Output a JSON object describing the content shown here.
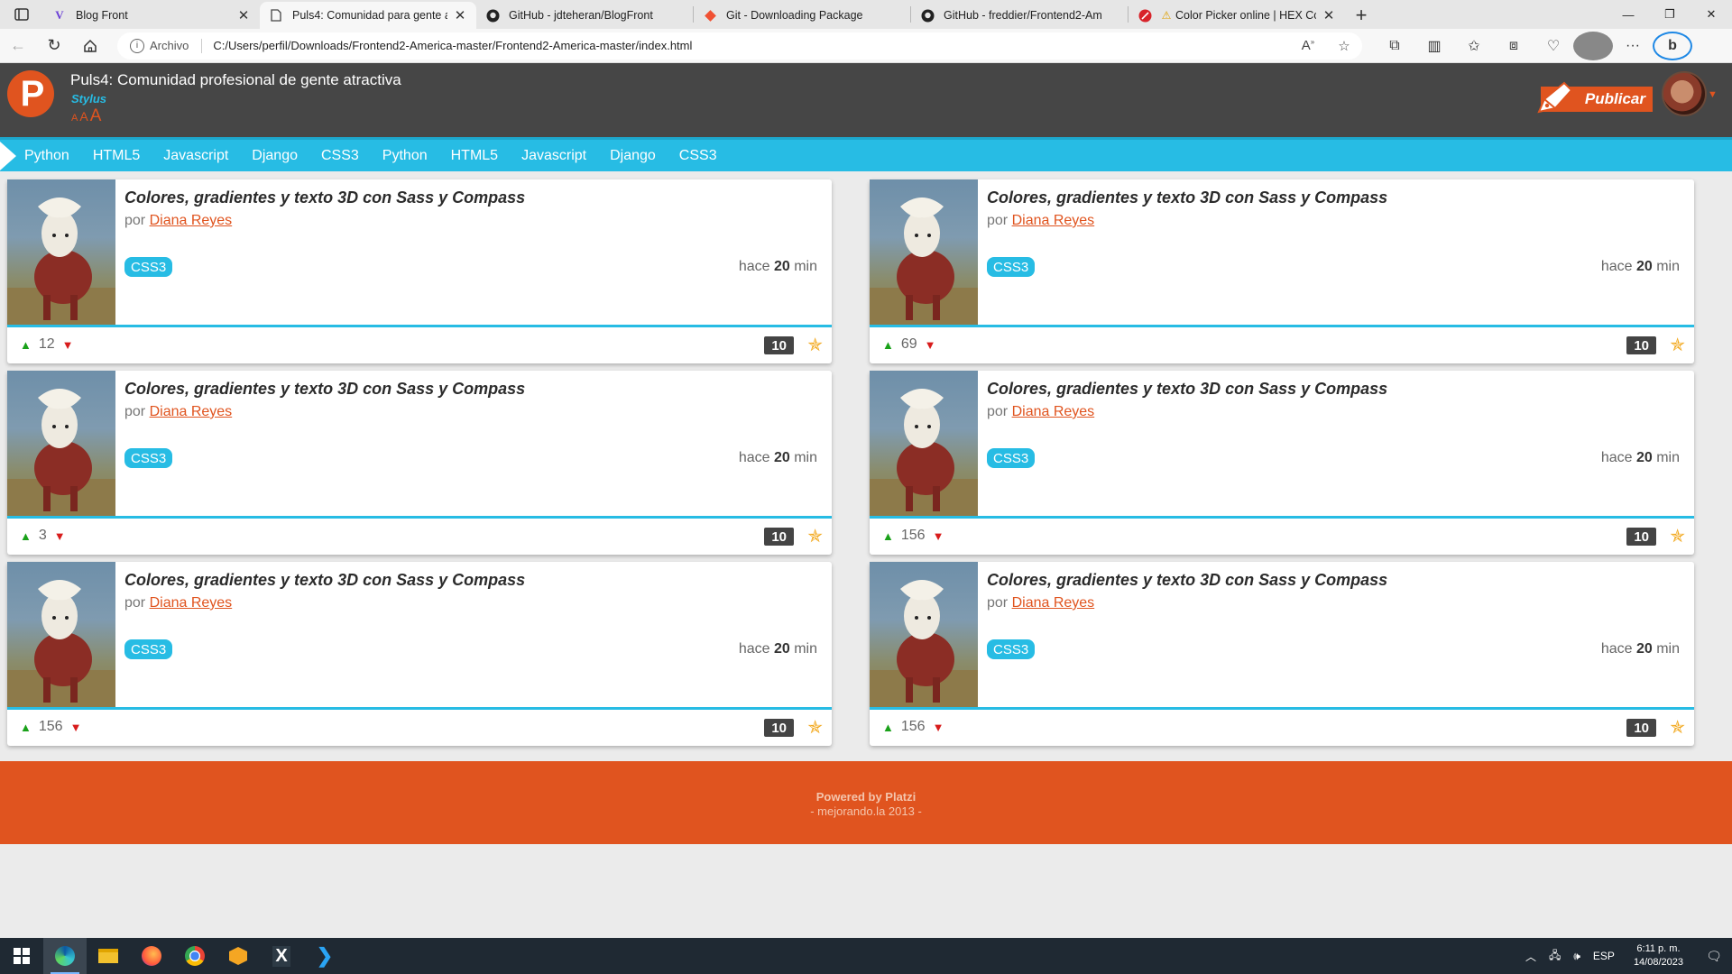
{
  "browser": {
    "tabs": [
      {
        "title": "Blog Front",
        "favicon": "v-logo-icon",
        "active": false
      },
      {
        "title": "Puls4: Comunidad para gente atr",
        "favicon": "page-icon",
        "active": true
      },
      {
        "title": "GitHub - jdteheran/BlogFront",
        "favicon": "github-icon",
        "active": false
      },
      {
        "title": "Git - Downloading Package",
        "favicon": "git-icon",
        "active": false
      },
      {
        "title": "GitHub - freddier/Frontend2-Am",
        "favicon": "github-icon",
        "active": false
      },
      {
        "title": "Color Picker online | HEX Colo",
        "favicon": "color-picker-icon",
        "active": false
      }
    ],
    "address": {
      "scheme_label": "Archivo",
      "url": "C:/Users/perfil/Downloads/Frontend2-America-master/Frontend2-America-master/index.html"
    }
  },
  "site": {
    "logo_letter": "P",
    "title": "Puls4: Comunidad profesional de gente atractiva",
    "subtitle": "Stylus",
    "font_sizer": [
      "A",
      "A",
      "A"
    ],
    "publish_label": "Publicar",
    "nav_tags": [
      "Python",
      "HTML5",
      "Javascript",
      "Django",
      "CSS3",
      "Python",
      "HTML5",
      "Javascript",
      "Django",
      "CSS3"
    ]
  },
  "posts": [
    {
      "title": "Colores, gradientes y texto 3D con Sass y Compass",
      "by": "por",
      "author": "Diana Reyes",
      "tag": "CSS3",
      "time_prefix": "hace",
      "time_value": "20",
      "time_unit": "min",
      "votes": "12",
      "count": "10"
    },
    {
      "title": "Colores, gradientes y texto 3D con Sass y Compass",
      "by": "por",
      "author": "Diana Reyes",
      "tag": "CSS3",
      "time_prefix": "hace",
      "time_value": "20",
      "time_unit": "min",
      "votes": "69",
      "count": "10"
    },
    {
      "title": "Colores, gradientes y texto 3D con Sass y Compass",
      "by": "por",
      "author": "Diana Reyes",
      "tag": "CSS3",
      "time_prefix": "hace",
      "time_value": "20",
      "time_unit": "min",
      "votes": "3",
      "count": "10"
    },
    {
      "title": "Colores, gradientes y texto 3D con Sass y Compass",
      "by": "por",
      "author": "Diana Reyes",
      "tag": "CSS3",
      "time_prefix": "hace",
      "time_value": "20",
      "time_unit": "min",
      "votes": "156",
      "count": "10"
    },
    {
      "title": "Colores, gradientes y texto 3D con Sass y Compass",
      "by": "por",
      "author": "Diana Reyes",
      "tag": "CSS3",
      "time_prefix": "hace",
      "time_value": "20",
      "time_unit": "min",
      "votes": "156",
      "count": "10"
    },
    {
      "title": "Colores, gradientes y texto 3D con Sass y Compass",
      "by": "por",
      "author": "Diana Reyes",
      "tag": "CSS3",
      "time_prefix": "hace",
      "time_value": "20",
      "time_unit": "min",
      "votes": "156",
      "count": "10"
    }
  ],
  "footer": {
    "line1": "Powered by Platzi",
    "line2": "- mejorando.la 2013 -"
  },
  "taskbar": {
    "apps": [
      "edge-icon",
      "file-explorer-icon",
      "firefox-icon",
      "chrome-icon",
      "app-cube-icon",
      "x-app-icon",
      "vscode-icon"
    ],
    "language": "ESP",
    "time": "6:11 p. m.",
    "date": "14/08/2023"
  },
  "colors": {
    "accent_orange": "#e0541f",
    "accent_cyan": "#27bce4",
    "header_gray": "#464646"
  }
}
